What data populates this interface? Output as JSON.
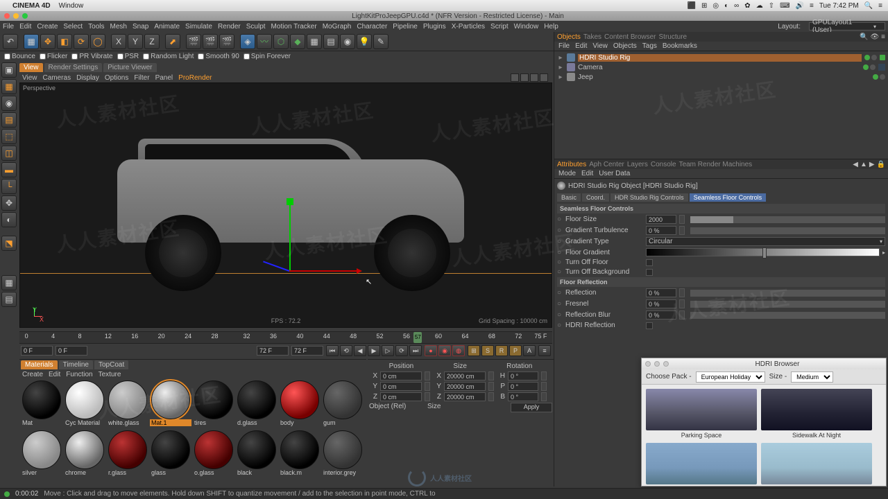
{
  "mac": {
    "apple": "",
    "app": "CINEMA 4D",
    "menu": "Window",
    "clock": "Tue 7:42 PM",
    "tray_icons": [
      "⬛",
      "⊞",
      "⚙",
      "◑",
      "∞",
      "⬤",
      "☁",
      "⬆",
      "⌨",
      "🔊",
      "🔋",
      "✽",
      "≡"
    ]
  },
  "doc": {
    "title": "LightKitProJeepGPU.c4d * (NFR Version - Restricted License) - Main"
  },
  "menu": [
    "File",
    "Edit",
    "Create",
    "Select",
    "Tools",
    "Mesh",
    "Snap",
    "Animate",
    "Simulate",
    "Render",
    "Sculpt",
    "Motion Tracker",
    "MoGraph",
    "Character",
    "Pipeline",
    "Plugins",
    "X-Particles",
    "Script",
    "Window",
    "Help"
  ],
  "layout": {
    "label": "Layout:",
    "value": "GPULayout1 (User)"
  },
  "sub_toolbar": {
    "bounce": "Bounce",
    "flicker": "Flicker",
    "pr": "PR Vibrate",
    "psr": "PSR",
    "random": "Random Light",
    "smooth": "Smooth 90",
    "spin": "Spin Forever"
  },
  "view_tabs": [
    "View",
    "Render Settings",
    "Picture Viewer"
  ],
  "view_menu": [
    "View",
    "Cameras",
    "Display",
    "Options",
    "Filter",
    "Panel",
    "ProRender"
  ],
  "viewport": {
    "label": "Perspective",
    "fps": "FPS : 72.2",
    "grid": "Grid Spacing : 10000 cm"
  },
  "timeline": {
    "ticks": [
      "0",
      "4",
      "8",
      "12",
      "16",
      "20",
      "24",
      "28",
      "32",
      "36",
      "40",
      "44",
      "48",
      "52",
      "56",
      "60",
      "64",
      "68",
      "72"
    ],
    "cursor": "57",
    "end_label": "75 F",
    "start": "0 F",
    "cur": "0 F",
    "end": "72 F",
    "end2": "72 F"
  },
  "materials": {
    "tabs": [
      "Materials",
      "Timeline",
      "TopCoat"
    ],
    "menu": [
      "Create",
      "Edit",
      "Function",
      "Texture"
    ],
    "row1": [
      {
        "n": "Mat",
        "c": "dark"
      },
      {
        "n": "Cyc Material",
        "c": "white"
      },
      {
        "n": "white.glass",
        "c": "glass"
      },
      {
        "n": "Mat.1",
        "c": "chrome",
        "sel": true
      },
      {
        "n": "tires",
        "c": "dark"
      },
      {
        "n": "d.glass",
        "c": "dark"
      },
      {
        "n": "body",
        "c": "red"
      },
      {
        "n": "gum",
        "c": "gum"
      }
    ],
    "row2": [
      {
        "n": "silver",
        "c": "glass"
      },
      {
        "n": "chrome",
        "c": "chrome"
      },
      {
        "n": "r.glass",
        "c": "dred"
      },
      {
        "n": "glass",
        "c": "dark"
      },
      {
        "n": "o.glass",
        "c": "dred"
      },
      {
        "n": "black",
        "c": "dark"
      },
      {
        "n": "black.m",
        "c": "dark"
      },
      {
        "n": "interior.grey",
        "c": "gum"
      }
    ]
  },
  "coord": {
    "hdrs": [
      "Position",
      "Size",
      "Rotation"
    ],
    "rows": [
      {
        "a": "X",
        "p": "0 cm",
        "sl": "X",
        "s": "20000 cm",
        "rl": "H",
        "r": "0 °"
      },
      {
        "a": "Y",
        "p": "0 cm",
        "sl": "Y",
        "s": "20000 cm",
        "rl": "P",
        "r": "0 °"
      },
      {
        "a": "Z",
        "p": "0 cm",
        "sl": "Z",
        "s": "20000 cm",
        "rl": "B",
        "r": "0 °"
      }
    ],
    "mode": "Object (Rel)",
    "size_mode": "Size",
    "apply": "Apply"
  },
  "objects": {
    "tabs": [
      "Objects",
      "Takes",
      "Content Browser",
      "Structure"
    ],
    "menu": [
      "File",
      "Edit",
      "View",
      "Objects",
      "Tags",
      "Bookmarks"
    ],
    "tree": [
      {
        "n": "HDRI Studio Rig",
        "ico": "rig",
        "sel": true,
        "dots": true,
        "chk": true
      },
      {
        "n": "Camera",
        "ico": "cam",
        "dots": true,
        "tag": true
      },
      {
        "n": "Jeep",
        "ico": "null",
        "dots": true
      }
    ]
  },
  "attributes": {
    "tabs": [
      "Attributes",
      "Aph Center",
      "Layers",
      "Console",
      "Team Render Machines"
    ],
    "menu": [
      "Mode",
      "Edit",
      "User Data"
    ],
    "title": "HDRI Studio Rig Object [HDRI Studio Rig]",
    "subtabs": [
      "Basic",
      "Coord.",
      "HDR Studio Rig Controls",
      "Seamless Floor Controls"
    ],
    "sec1": "Seamless Floor Controls",
    "floor_size_l": "Floor Size",
    "floor_size_v": "2000",
    "grad_turb_l": "Gradient Turbulence",
    "grad_turb_v": "0 %",
    "grad_type_l": "Gradient Type",
    "grad_type_v": "Circular",
    "floor_grad_l": "Floor Gradient",
    "turn_floor_l": "Turn Off Floor",
    "turn_bg_l": "Turn Off Background",
    "sec2": "Floor Reflection",
    "refl_l": "Reflection",
    "refl_v": "0 %",
    "fresnel_l": "Fresnel",
    "fresnel_v": "0 %",
    "rblur_l": "Reflection Blur",
    "rblur_v": "0 %",
    "hdri_refl_l": "HDRI Reflection"
  },
  "hdri": {
    "title": "HDRI Browser",
    "pack_l": "Choose Pack -",
    "pack_v": "European Holiday",
    "size_l": "Size -",
    "size_v": "Medium",
    "items": [
      "Parking Space",
      "Sidewalk At Night",
      "",
      ""
    ]
  },
  "status": {
    "time": "0:00:02",
    "msg": "Move : Click and drag to move elements. Hold down SHIFT to quantize movement / add to the selection in point mode, CTRL to"
  },
  "watermark": "人人素材社区"
}
